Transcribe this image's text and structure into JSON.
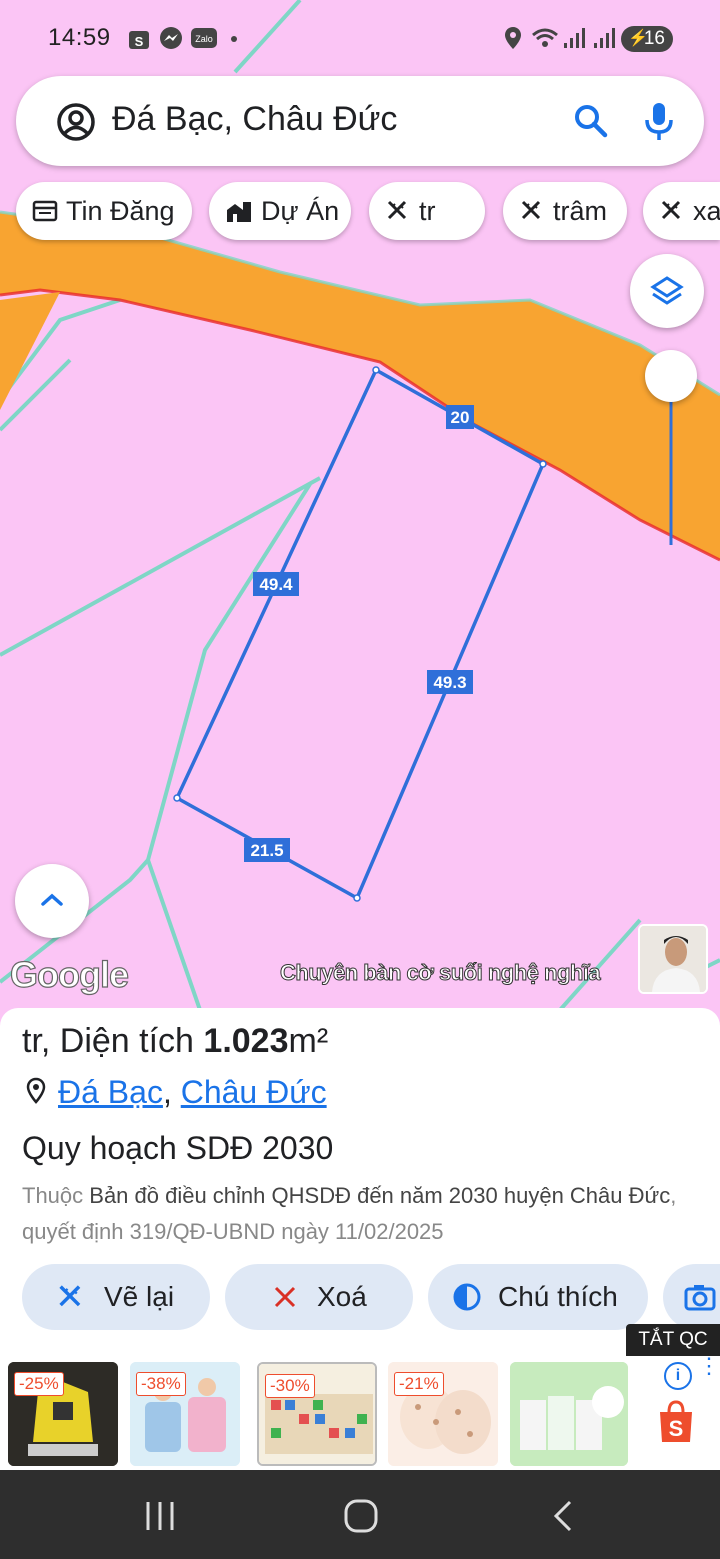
{
  "status_bar": {
    "time": "14:59",
    "battery": "16",
    "icons": [
      "shopee-icon",
      "messenger-icon",
      "zalo-icon",
      "location-icon",
      "wifi-icon",
      "signal-icon",
      "battery-icon"
    ]
  },
  "search": {
    "value": "Đá Bạc, Châu Đức"
  },
  "chips": [
    {
      "label": "Tin Đăng",
      "icon": "listing-icon"
    },
    {
      "label": "Dự Án",
      "icon": "buildings-icon"
    },
    {
      "label": "tr",
      "icon": "ruler-icon"
    },
    {
      "label": "trâm",
      "icon": "ruler-icon"
    },
    {
      "label": "xa",
      "icon": "ruler-icon"
    }
  ],
  "map": {
    "edge_labels": [
      "20",
      "49.4",
      "49.3",
      "21.5"
    ],
    "attribution": "Google",
    "caption": "Chuyên bàn cờ suối nghệ nghĩa",
    "colors": {
      "land": "#fbc5f5",
      "road": "#f8a431",
      "road_edge": "#e8282a",
      "boundary": "#7fd6c6",
      "parcel": "#2f6fd9"
    }
  },
  "sheet": {
    "title_prefix": "tr, Diện tích ",
    "area": "1.023",
    "area_unit": "m²",
    "location_part1": "Đá Bạc",
    "location_sep": ", ",
    "location_part2": "Châu Đức",
    "plan_title": "Quy hoạch SDĐ 2030",
    "plan_prefix": "Thuộc ",
    "plan_map": "Bản đồ điều chỉnh QHSDĐ đến năm 2030 huyện Châu Đức",
    "plan_decision": ", quyết định 319/QĐ-UBND ngày 11/02/2025"
  },
  "actions": [
    {
      "label": "Vẽ lại"
    },
    {
      "label": "Xoá"
    },
    {
      "label": "Chú thích"
    }
  ],
  "ads": {
    "label": "TẮT QC",
    "discounts": [
      "-25%",
      "-38%",
      "-30%",
      "-21%"
    ]
  }
}
